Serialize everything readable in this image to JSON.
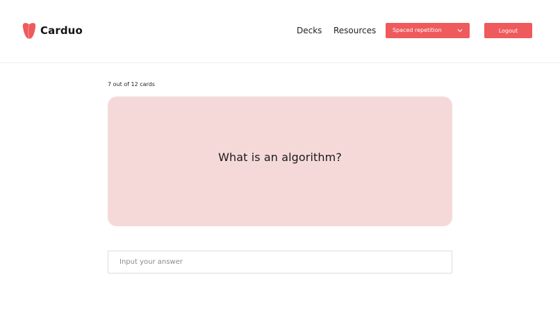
{
  "brand": {
    "name": "Carduo",
    "logo_icon": "tooth-shaped-logo-icon",
    "color": "#ef5a5c"
  },
  "nav": {
    "items": [
      {
        "label": "Decks"
      },
      {
        "label": "Resources"
      }
    ],
    "mode_select": {
      "selected": "Spaced repetition",
      "icon": "chevron-down-icon"
    },
    "logout_label": "Logout"
  },
  "study": {
    "progress_text": "7 out of 12 cards",
    "card": {
      "question": "What is an algorithm?",
      "background": "#f5d9d9"
    },
    "answer": {
      "placeholder": "Input your answer",
      "value": ""
    }
  },
  "colors": {
    "accent": "#ef5a5c",
    "card": "#f5d9d9",
    "text": "#1a1a1a"
  }
}
